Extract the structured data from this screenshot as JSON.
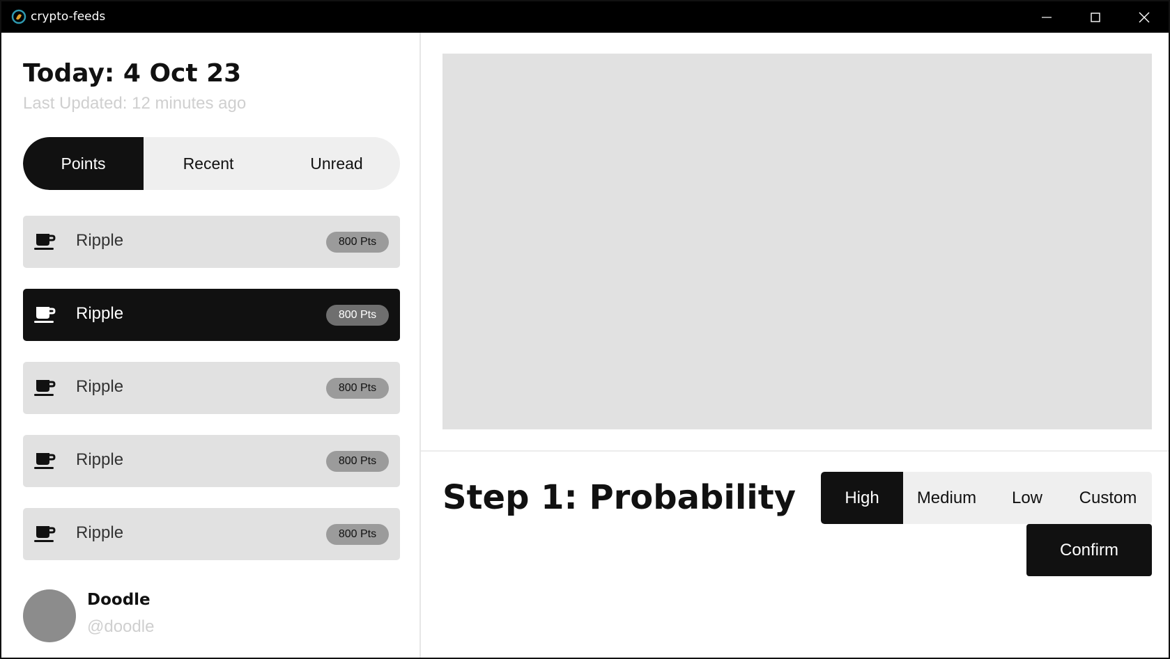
{
  "window": {
    "title": "crypto-feeds",
    "icon": "app-logo-icon",
    "controls": [
      "minimize-icon",
      "maximize-icon",
      "close-icon"
    ]
  },
  "left": {
    "today": "Today: 4 Oct 23",
    "last_updated": "Last Updated: 12 minutes ago",
    "tabs": [
      {
        "label": "Points",
        "active": true
      },
      {
        "label": "Recent",
        "active": false
      },
      {
        "label": "Unread",
        "active": false
      }
    ],
    "feed": [
      {
        "name": "Ripple",
        "points": "800 Pts",
        "icon": "coffee-cup-icon",
        "selected": false
      },
      {
        "name": "Ripple",
        "points": "800 Pts",
        "icon": "coffee-cup-icon",
        "selected": true
      },
      {
        "name": "Ripple",
        "points": "800 Pts",
        "icon": "coffee-cup-icon",
        "selected": false
      },
      {
        "name": "Ripple",
        "points": "800 Pts",
        "icon": "coffee-cup-icon",
        "selected": false
      },
      {
        "name": "Ripple",
        "points": "800 Pts",
        "icon": "coffee-cup-icon",
        "selected": false
      }
    ],
    "profile": {
      "name": "Doodle",
      "handle": "@doodle"
    }
  },
  "right": {
    "step_title": "Step 1: Probability",
    "options": [
      {
        "label": "High",
        "active": true
      },
      {
        "label": "Medium",
        "active": false
      },
      {
        "label": "Low",
        "active": false
      },
      {
        "label": "Custom",
        "active": false
      }
    ],
    "confirm_label": "Confirm"
  },
  "colors": {
    "primary": "#111111",
    "surface": "#e1e1e1",
    "segment_bg": "#efefef",
    "muted_text": "#cfcfcf",
    "badge": "#9b9b9b"
  }
}
